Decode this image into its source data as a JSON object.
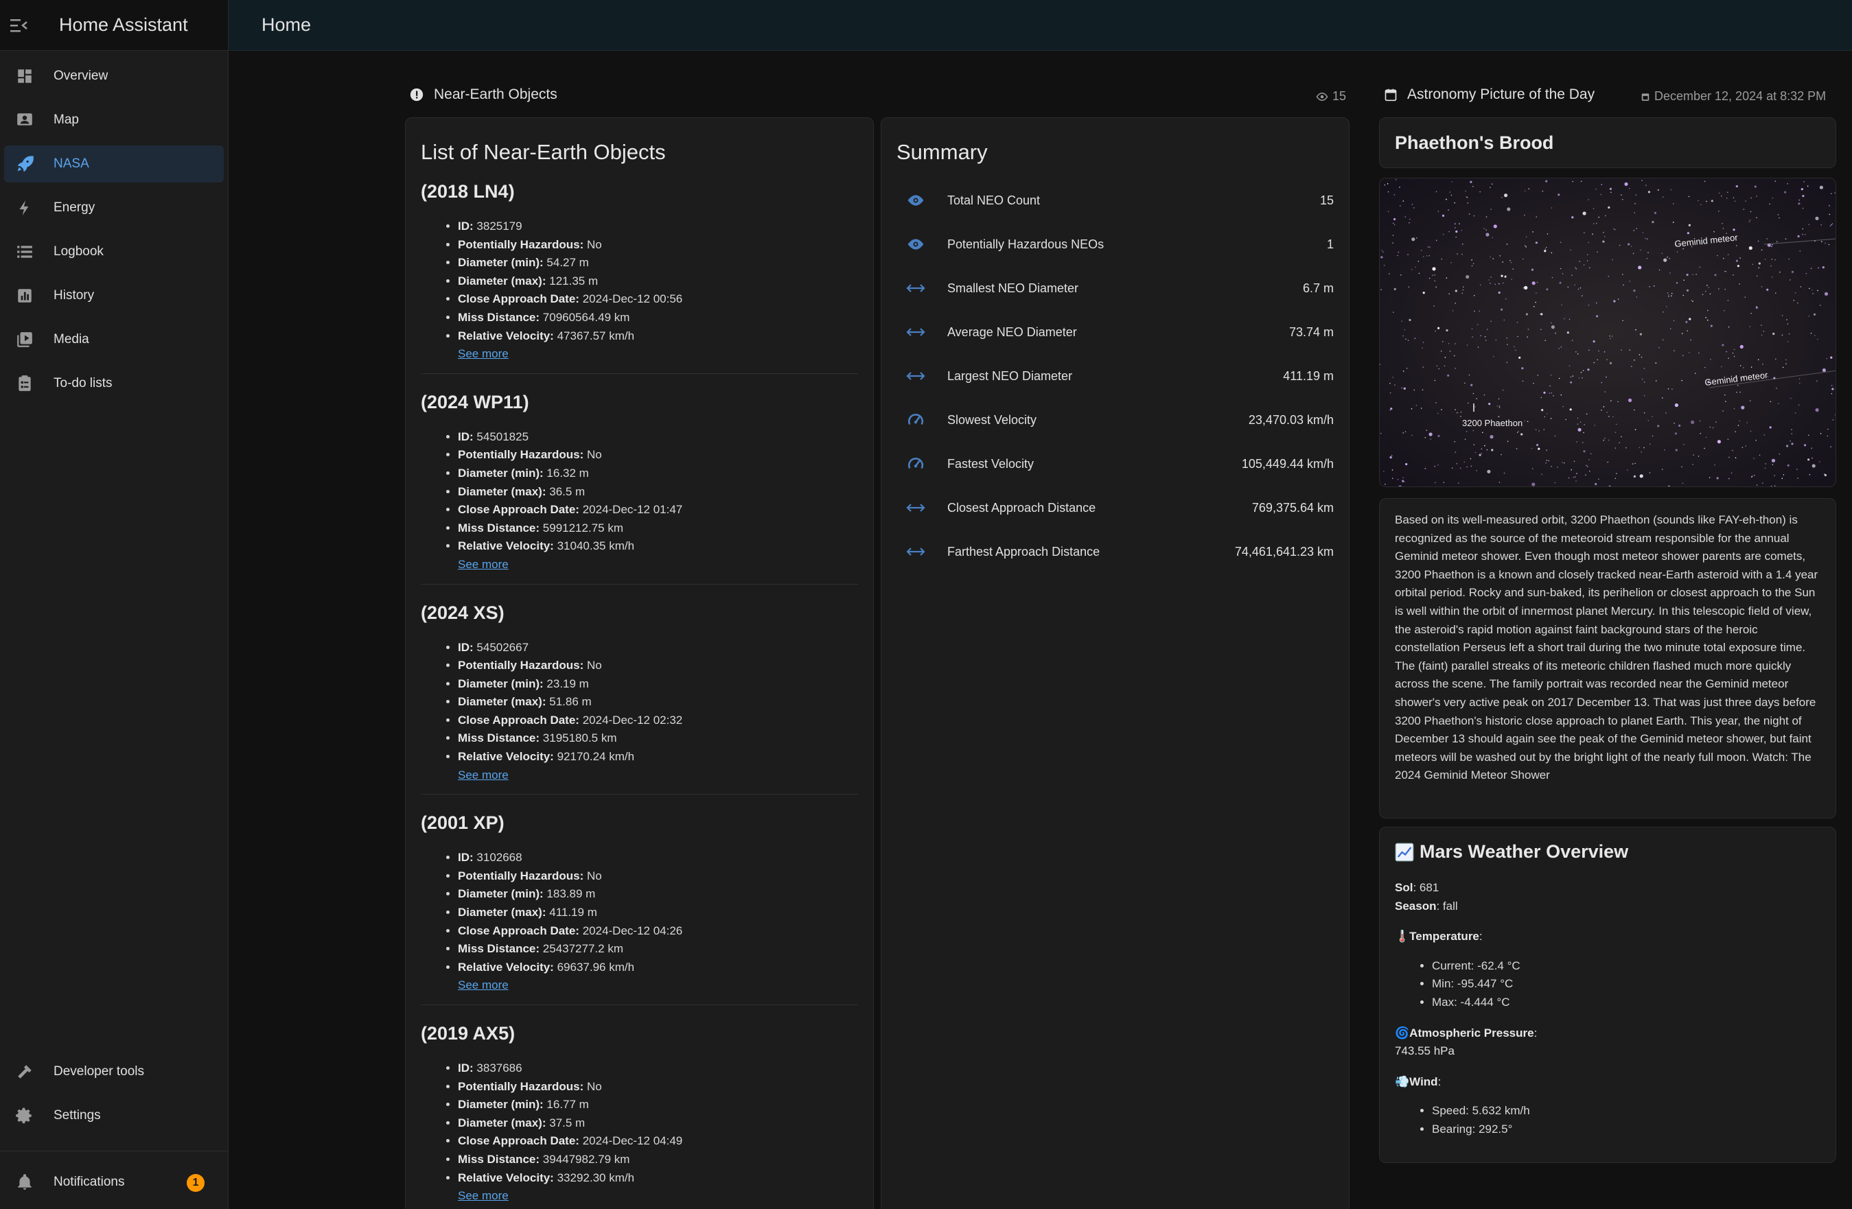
{
  "app": {
    "title": "Home Assistant",
    "page_title": "Home"
  },
  "sidebar": {
    "items": [
      {
        "label": "Overview",
        "icon": "dashboard-icon"
      },
      {
        "label": "Map",
        "icon": "map-icon"
      },
      {
        "label": "NASA",
        "icon": "rocket-icon",
        "active": true
      },
      {
        "label": "Energy",
        "icon": "lightning-icon"
      },
      {
        "label": "Logbook",
        "icon": "list-icon"
      },
      {
        "label": "History",
        "icon": "chart-icon"
      },
      {
        "label": "Media",
        "icon": "media-icon"
      },
      {
        "label": "To-do lists",
        "icon": "clipboard-icon"
      }
    ],
    "bottom": [
      {
        "label": "Developer tools",
        "icon": "hammer-icon"
      },
      {
        "label": "Settings",
        "icon": "gear-icon"
      }
    ],
    "notifications": {
      "label": "Notifications",
      "count": "1"
    }
  },
  "neo_section": {
    "header": "Near-Earth Objects",
    "count": "15"
  },
  "apod_section": {
    "header": "Astronomy Picture of the Day",
    "date": "December 12, 2024 at 8:32 PM"
  },
  "neo_list": {
    "title": "List of Near-Earth Objects",
    "field_labels": {
      "id": "ID:",
      "hazard": "Potentially Hazardous:",
      "dmin": "Diameter (min):",
      "dmax": "Diameter (max):",
      "date": "Close Approach Date:",
      "miss": "Miss Distance:",
      "vel": "Relative Velocity:"
    },
    "see_more": "See more",
    "items": [
      {
        "name": "(2018 LN4)",
        "id": "3825179",
        "hazard": "No",
        "dmin": "54.27 m",
        "dmax": "121.35 m",
        "date": "2024-Dec-12 00:56",
        "miss": "70960564.49 km",
        "vel": "47367.57 km/h"
      },
      {
        "name": "(2024 WP11)",
        "id": "54501825",
        "hazard": "No",
        "dmin": "16.32 m",
        "dmax": "36.5 m",
        "date": "2024-Dec-12 01:47",
        "miss": "5991212.75 km",
        "vel": "31040.35 km/h"
      },
      {
        "name": "(2024 XS)",
        "id": "54502667",
        "hazard": "No",
        "dmin": "23.19 m",
        "dmax": "51.86 m",
        "date": "2024-Dec-12 02:32",
        "miss": "3195180.5 km",
        "vel": "92170.24 km/h"
      },
      {
        "name": "(2001 XP)",
        "id": "3102668",
        "hazard": "No",
        "dmin": "183.89 m",
        "dmax": "411.19 m",
        "date": "2024-Dec-12 04:26",
        "miss": "25437277.2 km",
        "vel": "69637.96 km/h"
      },
      {
        "name": "(2019 AX5)",
        "id": "3837686",
        "hazard": "No",
        "dmin": "16.77 m",
        "dmax": "37.5 m",
        "date": "2024-Dec-12 04:49",
        "miss": "39447982.79 km",
        "vel": "33292.30 km/h"
      }
    ]
  },
  "summary": {
    "title": "Summary",
    "rows": [
      {
        "label": "Total NEO Count",
        "value": "15",
        "icon": "eye-icon"
      },
      {
        "label": "Potentially Hazardous NEOs",
        "value": "1",
        "icon": "eye-icon"
      },
      {
        "label": "Smallest NEO Diameter",
        "value": "6.7 m",
        "icon": "arrow-horizontal-icon"
      },
      {
        "label": "Average NEO Diameter",
        "value": "73.74 m",
        "icon": "arrow-horizontal-icon"
      },
      {
        "label": "Largest NEO Diameter",
        "value": "411.19 m",
        "icon": "arrow-horizontal-icon"
      },
      {
        "label": "Slowest Velocity",
        "value": "23,470.03 km/h",
        "icon": "speedometer-icon"
      },
      {
        "label": "Fastest Velocity",
        "value": "105,449.44 km/h",
        "icon": "speedometer-icon"
      },
      {
        "label": "Closest Approach Distance",
        "value": "769,375.64 km",
        "icon": "arrow-horizontal-icon"
      },
      {
        "label": "Farthest Approach Distance",
        "value": "74,461,641.23 km",
        "icon": "arrow-horizontal-icon"
      }
    ]
  },
  "apod": {
    "title": "Phaethon's Brood",
    "image_labels": {
      "meteor1": "Geminid meteor",
      "meteor2": "Geminid meteor",
      "phaethon": "3200 Phaethon"
    },
    "explanation": "Based on its well-measured orbit, 3200 Phaethon (sounds like FAY-eh-thon) is recognized as the source of the meteoroid stream responsible for the annual Geminid meteor shower. Even though most meteor shower parents are comets, 3200 Phaethon is a known and closely tracked near-Earth asteroid with a 1.4 year orbital period. Rocky and sun-baked, its perihelion or closest approach to the Sun is well within the orbit of innermost planet Mercury. In this telescopic field of view, the asteroid's rapid motion against faint background stars of the heroic constellation Perseus left a short trail during the two minute total exposure time. The (faint) parallel streaks of its meteoric children flashed much more quickly across the scene. The family portrait was recorded near the Geminid meteor shower's very active peak on 2017 December 13. That was just three days before 3200 Phaethon's historic close approach to planet Earth. This year, the night of December 13 should again see the peak of the Geminid meteor shower, but faint meteors will be washed out by the bright light of the nearly full moon. Watch: The 2024 Geminid Meteor Shower"
  },
  "mars": {
    "title": "Mars Weather Overview",
    "sol_label": "Sol",
    "sol": ": 681",
    "season_label": "Season",
    "season": ": fall",
    "temp_label": "Temperature",
    "temp_items": [
      "Current: -62.4 °C",
      "Min: -95.447 °C",
      "Max: -4.444 °C"
    ],
    "pressure_label": "Atmospheric Pressure",
    "pressure": "743.55 hPa",
    "wind_label": "Wind",
    "wind_items": [
      "Speed: 5.632 km/h",
      "Bearing: 292.5°"
    ]
  }
}
